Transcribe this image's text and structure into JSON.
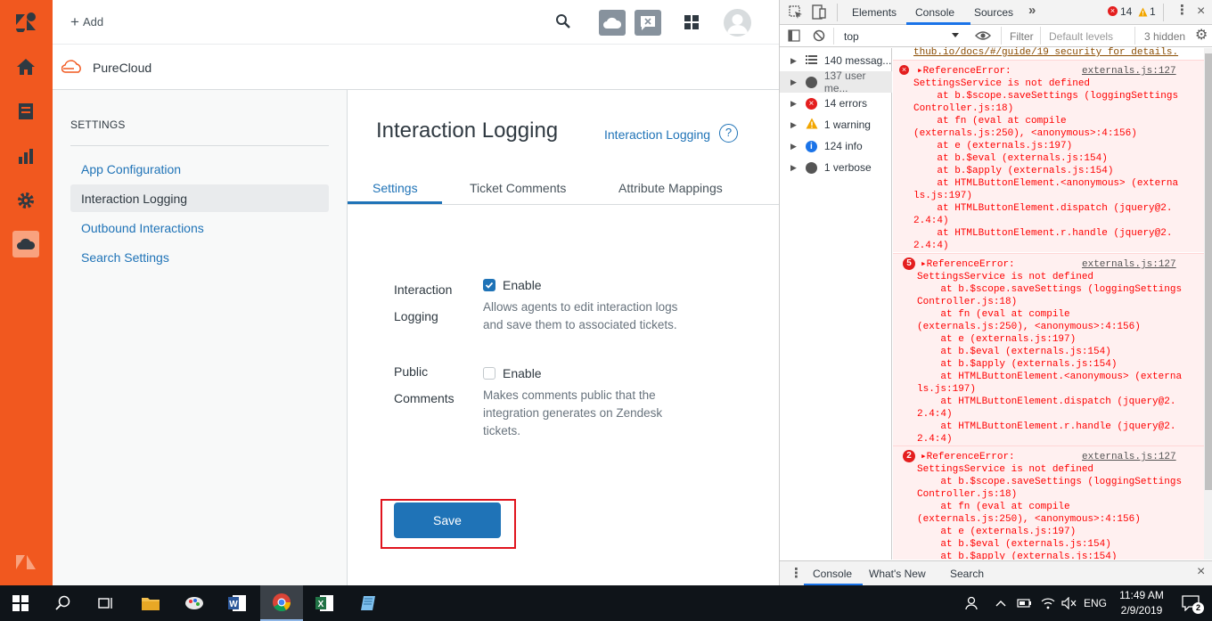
{
  "topbar": {
    "add_label": "Add"
  },
  "app": {
    "name": "PureCloud"
  },
  "settings_nav": {
    "heading": "SETTINGS",
    "items": [
      "App Configuration",
      "Interaction Logging",
      "Outbound Interactions",
      "Search Settings"
    ]
  },
  "main": {
    "title": "Interaction Logging",
    "help_link": "Interaction Logging",
    "tabs": [
      "Settings",
      "Ticket Comments",
      "Attribute Mappings"
    ],
    "fields": [
      {
        "label_line1": "Interaction",
        "label_line2": "Logging",
        "checkbox_label": "Enable",
        "checked": true,
        "desc": [
          "Allows agents to edit interaction logs",
          "and save them to associated tickets."
        ]
      },
      {
        "label_line1": "Public",
        "label_line2": "Comments",
        "checkbox_label": "Enable",
        "checked": false,
        "desc": [
          "Makes comments public that the",
          "integration generates on Zendesk",
          "tickets."
        ]
      }
    ],
    "save_label": "Save"
  },
  "devtools": {
    "tabs": [
      "Elements",
      "Console",
      "Sources"
    ],
    "error_count": "14",
    "warning_count": "1",
    "context": "top",
    "filter_placeholder": "Filter",
    "levels": "Default levels",
    "hidden": "3 hidden",
    "sidebar": [
      {
        "label": "140 messag..."
      },
      {
        "label": "137 user me..."
      },
      {
        "label": "14 errors"
      },
      {
        "label": "1 warning"
      },
      {
        "label": "124 info"
      },
      {
        "label": "1 verbose"
      }
    ],
    "top_line": "thub.io/docs/#/guide/19 security for details.",
    "errors": [
      {
        "count": "",
        "header": "ReferenceError:",
        "source": "externals.js:127"
      },
      {
        "count": "5",
        "header": "ReferenceError:",
        "source": "externals.js:127"
      },
      {
        "count": "2",
        "header": "ReferenceError:",
        "source": "externals.js:127"
      }
    ],
    "stack": [
      "SettingsService is not defined",
      "    at b.$scope.saveSettings (loggingSettings",
      "Controller.js:18)",
      "    at fn (eval at compile",
      "(externals.js:250), <anonymous>:4:156)",
      "    at e (externals.js:197)",
      "    at b.$eval (externals.js:154)",
      "    at b.$apply (externals.js:154)",
      "    at HTMLButtonElement.<anonymous> (externa",
      "ls.js:197)",
      "    at HTMLButtonElement.dispatch (jquery@2.",
      "2.4:4)",
      "    at HTMLButtonElement.r.handle (jquery@2.",
      "2.4:4)"
    ],
    "drawer_tabs": [
      "Console",
      "What's New",
      "Search"
    ]
  },
  "taskbar": {
    "time": "11:49 AM",
    "date": "2/9/2019",
    "lang": "ENG",
    "notif": "2"
  }
}
